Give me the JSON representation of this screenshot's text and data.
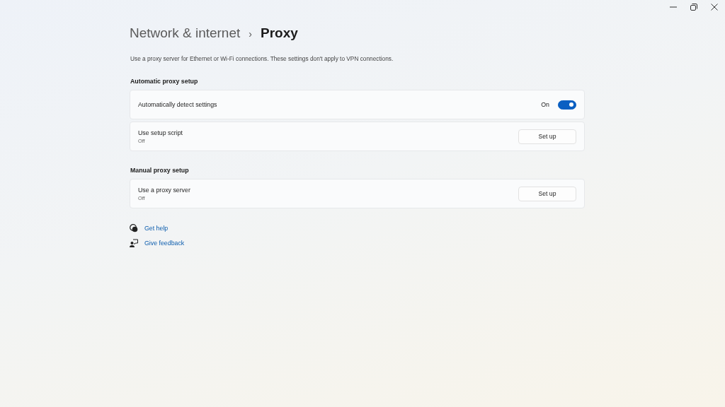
{
  "breadcrumb": {
    "parent": "Network & internet",
    "separator": "›",
    "current": "Proxy"
  },
  "description": "Use a proxy server for Ethernet or Wi-Fi connections. These settings don't apply to VPN connections.",
  "sections": [
    {
      "heading": "Automatic proxy setup",
      "rows": [
        {
          "kind": "toggle",
          "label": "Automatically detect settings",
          "state_text": "On",
          "on": true
        },
        {
          "kind": "button",
          "label": "Use setup script",
          "subtitle": "Off",
          "button": "Set up"
        }
      ]
    },
    {
      "heading": "Manual proxy setup",
      "rows": [
        {
          "kind": "button",
          "label": "Use a proxy server",
          "subtitle": "Off",
          "button": "Set up"
        }
      ]
    }
  ],
  "links": [
    {
      "kind": "help",
      "label": "Get help"
    },
    {
      "kind": "feedback",
      "label": "Give feedback"
    }
  ]
}
